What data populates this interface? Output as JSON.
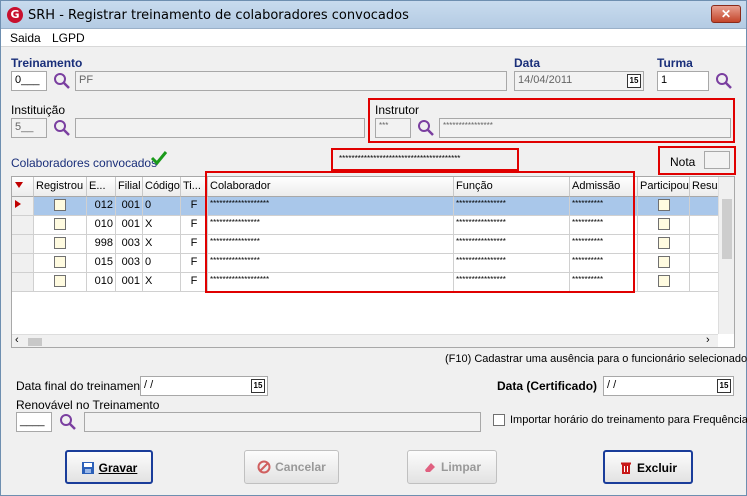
{
  "window": {
    "title": "SRH - Registrar treinamento de colaboradores convocados",
    "close": "✕"
  },
  "menu": {
    "items": [
      {
        "label": "Saida"
      },
      {
        "label": "LGPD"
      }
    ]
  },
  "treinamento": {
    "label": "Treinamento",
    "code": "0___",
    "name": "PF"
  },
  "data": {
    "label": "Data",
    "value": "14/04/2011"
  },
  "turma": {
    "label": "Turma",
    "value": "1"
  },
  "instituicao": {
    "label": "Instituição",
    "code": "5__",
    "name": ""
  },
  "instrutor": {
    "label": "Instrutor",
    "code": "***",
    "name": "****************"
  },
  "colaboradores_label": "Colaboradores convocados",
  "masked_center": "***************************************",
  "nota": {
    "label": "Nota",
    "value": ""
  },
  "grid": {
    "headers": [
      "",
      "Registrou",
      "E...",
      "Filial",
      "Código",
      "Ti...",
      "Colaborador",
      "Função",
      "Admissão",
      "Participou",
      "Resu"
    ],
    "rows": [
      {
        "e": "012",
        "filial": "001",
        "codigo": "0",
        "tipo": "F",
        "colaborador": "*******************",
        "funcao": "****************",
        "admissao": "**********"
      },
      {
        "e": "010",
        "filial": "001",
        "codigo": "X",
        "tipo": "F",
        "colaborador": "****************",
        "funcao": "****************",
        "admissao": "**********"
      },
      {
        "e": "998",
        "filial": "003",
        "codigo": "X",
        "tipo": "F",
        "colaborador": "****************",
        "funcao": "****************",
        "admissao": "**********"
      },
      {
        "e": "015",
        "filial": "003",
        "codigo": "0",
        "tipo": "F",
        "colaborador": "****************",
        "funcao": "****************",
        "admissao": "**********"
      },
      {
        "e": "010",
        "filial": "001",
        "codigo": "X",
        "tipo": "F",
        "colaborador": "*******************",
        "funcao": "****************",
        "admissao": "**********"
      }
    ]
  },
  "hint": "(F10) Cadastrar uma ausência para o funcionário selecionado",
  "data_final": {
    "label": "Data final do treinamento",
    "value": " /  /"
  },
  "data_certificado": {
    "label": "Data (Certificado)",
    "value": " /  /"
  },
  "renovavel": {
    "label": "Renovável no Treinamento",
    "code": "____",
    "name": ""
  },
  "importar": {
    "label": "Importar horário do treinamento para Frequência"
  },
  "buttons": {
    "gravar": "Gravar",
    "cancelar": "Cancelar",
    "limpar": "Limpar",
    "excluir": "Excluir"
  },
  "colors": {
    "accent": "#1a2f7a",
    "highlight": "#e00000",
    "selection": "#a9c7ea"
  }
}
